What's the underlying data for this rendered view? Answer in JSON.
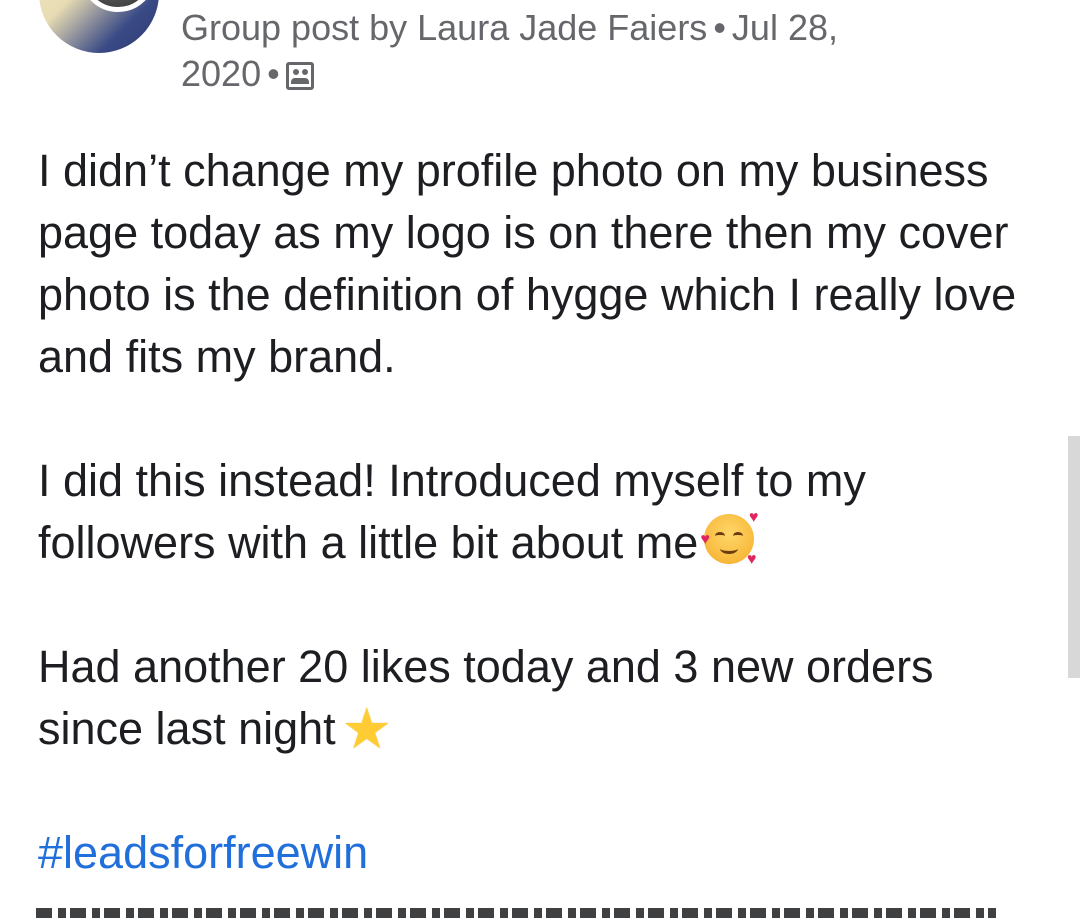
{
  "post": {
    "meta": {
      "prefix": "Group post by",
      "author": "Laura Jade Faiers",
      "separator": "•",
      "date": "Jul 28, 2020",
      "date_month_day": "Jul 28,",
      "date_year": "2020",
      "audience_icon": "group-icon"
    },
    "paragraphs": [
      "I didn’t change my profile photo on my business page today as my logo is on there then my cover photo is the definition of hygge which I really love and fits my brand.",
      "I did this instead! Introduced myself to my followers with a little bit about me",
      "Had another 20 likes today and 3 new orders since last night"
    ],
    "emojis": [
      "smiling-face-with-hearts-icon",
      "star-icon"
    ],
    "hashtag": "#leadsforfreewin"
  },
  "colors": {
    "text": "#1c1e21",
    "meta_text": "#65676b",
    "hashtag": "#216fdb",
    "background": "#ffffff"
  }
}
